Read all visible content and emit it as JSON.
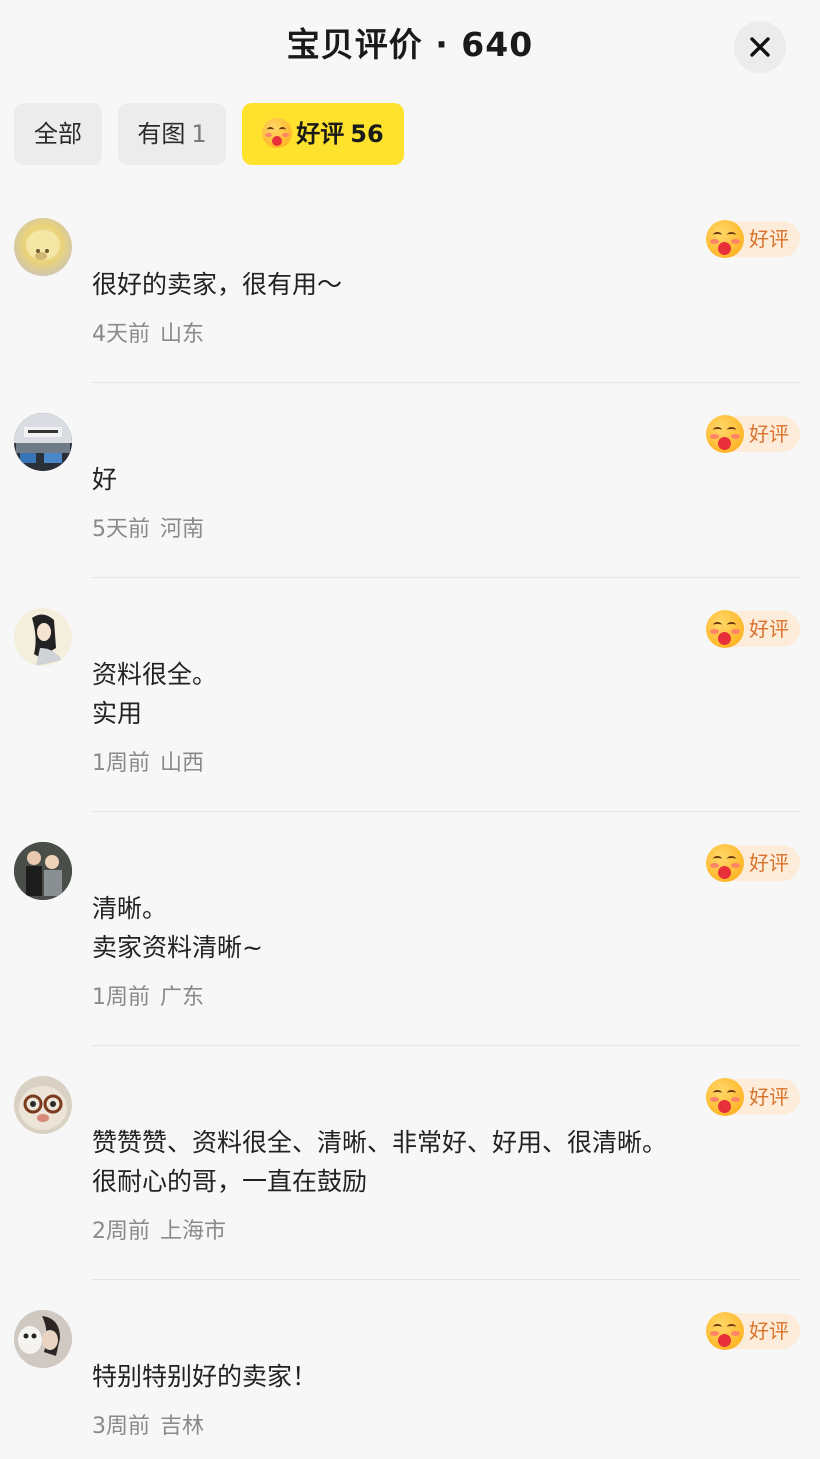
{
  "header": {
    "title": "宝贝评价 · 640",
    "close_icon": "close-icon"
  },
  "tabs": [
    {
      "label": "全部",
      "count": ""
    },
    {
      "label": "有图",
      "count": "1"
    },
    {
      "label": "好评",
      "count": "56",
      "icon": "kiss-emoji-icon",
      "active": true
    }
  ],
  "colors": {
    "accent": "#ffe22d",
    "badge_bg": "#fdecd9",
    "badge_text": "#d9722b",
    "meta_text": "#8a8a8a"
  },
  "reviews": [
    {
      "badge": "好评",
      "lines": [
        "很好的卖家，很有用～"
      ],
      "time": "4天前",
      "location": "山东"
    },
    {
      "badge": "好评",
      "lines": [
        "好"
      ],
      "time": "5天前",
      "location": "河南"
    },
    {
      "badge": "好评",
      "lines": [
        "资料很全。",
        "实用"
      ],
      "time": "1周前",
      "location": "山西"
    },
    {
      "badge": "好评",
      "lines": [
        "清晰。",
        "卖家资料清晰~"
      ],
      "time": "1周前",
      "location": "广东"
    },
    {
      "badge": "好评",
      "lines": [
        "赞赞赞、资料很全、清晰、非常好、好用、很清晰。",
        "很耐心的哥，一直在鼓励"
      ],
      "time": "2周前",
      "location": "上海市"
    },
    {
      "badge": "好评",
      "lines": [
        "特别特别好的卖家！"
      ],
      "time": "3周前",
      "location": "吉林"
    }
  ]
}
